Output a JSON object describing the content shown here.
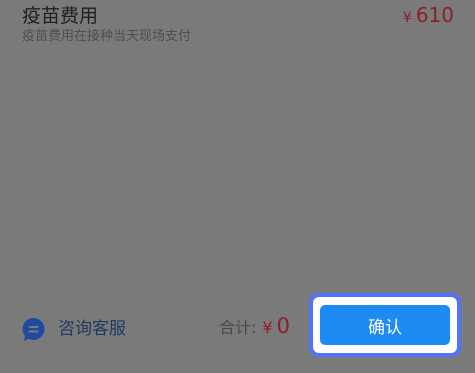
{
  "fee": {
    "title": "疫苗费用",
    "subtitle": "疫苗费用在接种当天现场支付",
    "currency": "¥",
    "amount": "610"
  },
  "footer": {
    "service_label": "咨询客服",
    "service_icon": "chat-icon",
    "total_label": "合计:",
    "total_currency": "¥",
    "total_amount": "0",
    "confirm_label": "确认"
  },
  "colors": {
    "overlay": "#7a7a7a",
    "price": "#8d1f2b",
    "service_icon": "#1e4aa0",
    "confirm_button": "#1e8bf3",
    "highlight_border": "#4f72ff"
  }
}
